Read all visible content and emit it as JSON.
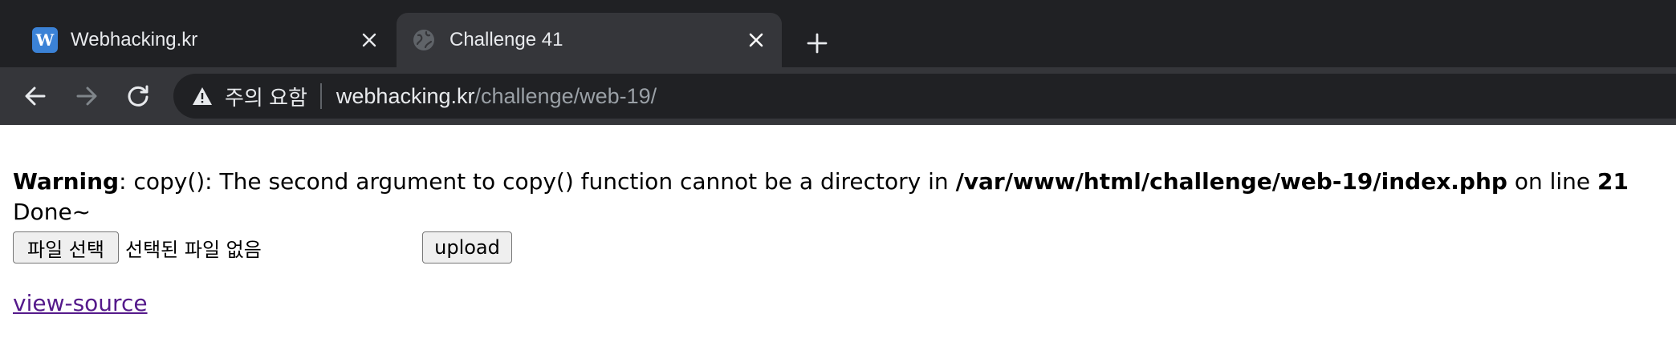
{
  "tabs": [
    {
      "title": "Webhacking.kr",
      "favicon_letter": "W",
      "favicon_color": "#3b82d6",
      "active": false,
      "close_icon": "close-icon"
    },
    {
      "title": "Challenge 41",
      "favicon": "globe-icon",
      "active": true,
      "close_icon": "close-icon"
    }
  ],
  "new_tab_icon": "plus-icon",
  "toolbar": {
    "back_icon": "arrow-left-icon",
    "forward_icon": "arrow-right-icon",
    "reload_icon": "reload-icon"
  },
  "omnibox": {
    "security_icon": "warning-triangle-icon",
    "security_label": "주의 요함",
    "url_host": "webhacking.kr",
    "url_path": "/challenge/web-19/"
  },
  "page": {
    "warning_label": "Warning",
    "warning_text": ": copy(): The second argument to copy() function cannot be a directory in ",
    "warning_path": "/var/www/html/challenge/web-19/index.php",
    "warning_line_text": " on line ",
    "warning_line_number": "21",
    "done_text": "Done~",
    "file_button_label": "파일 선택",
    "file_status": "선택된 파일 없음",
    "upload_label": "upload",
    "view_source_label": "view-source"
  },
  "colors": {
    "chrome_dark": "#202124",
    "chrome_toolbar": "#35363a",
    "link_visited": "#551a8b"
  }
}
